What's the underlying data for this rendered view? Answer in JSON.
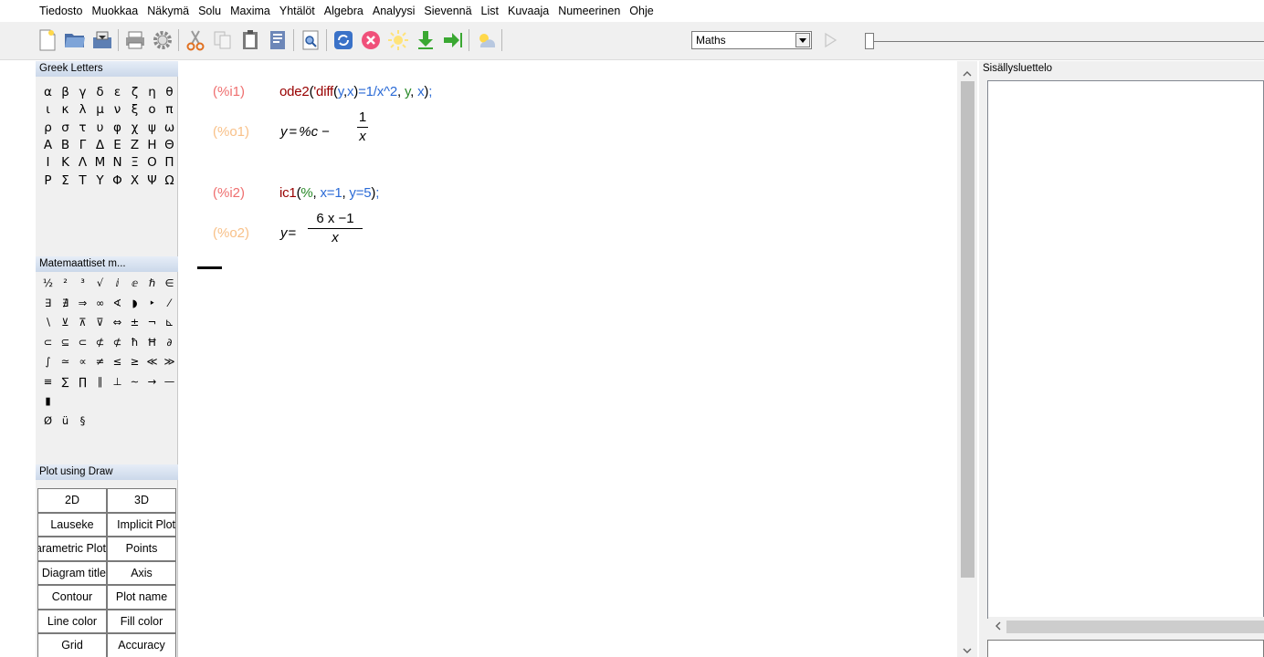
{
  "menu": [
    "Tiedosto",
    "Muokkaa",
    "Näkymä",
    "Solu",
    "Maxima",
    "Yhtälöt",
    "Algebra",
    "Analyysi",
    "Sievennä",
    "List",
    "Kuvaaja",
    "Numeerinen",
    "Ohje"
  ],
  "toolbar": {
    "cell_type": "Maths",
    "icons": [
      "new-document-icon",
      "open-folder-icon",
      "save-icon",
      "print-icon",
      "settings-gear-icon",
      "cut-scissors-icon",
      "copy-icon",
      "paste-icon",
      "select-all-icon",
      "find-icon",
      "interrupt-refresh-icon",
      "stop-icon",
      "sun-icon",
      "evaluate-down-icon",
      "evaluate-all-icon",
      "animation-icon",
      "play-icon"
    ]
  },
  "sidebar": {
    "greek": {
      "title": "Greek Letters",
      "rows": [
        [
          "α",
          "β",
          "γ",
          "δ",
          "ε",
          "ζ",
          "η",
          "θ"
        ],
        [
          "ι",
          "κ",
          "λ",
          "μ",
          "ν",
          "ξ",
          "ο",
          "π"
        ],
        [
          "ρ",
          "σ",
          "τ",
          "υ",
          "φ",
          "χ",
          "ψ",
          "ω"
        ],
        [
          "Α",
          "Β",
          "Γ",
          "Δ",
          "Ε",
          "Ζ",
          "Η",
          "Θ"
        ],
        [
          "Ι",
          "Κ",
          "Λ",
          "Μ",
          "Ν",
          "Ξ",
          "Ο",
          "Π"
        ],
        [
          "Ρ",
          "Σ",
          "Τ",
          "Υ",
          "Φ",
          "Χ",
          "Ψ",
          "Ω"
        ]
      ]
    },
    "math": {
      "title": "Matemaattiset m...",
      "rows": [
        [
          "½",
          "²",
          "³",
          "√",
          "ⅈ",
          "ⅇ",
          "ℏ",
          "∈"
        ],
        [
          "∃",
          "∄",
          "⇒",
          "∞",
          "∢",
          "◗",
          "‣",
          "⁄"
        ],
        [
          "∖",
          "⊻",
          "⊼",
          "⊽",
          "⇔",
          "±",
          "¬",
          "⊾"
        ],
        [
          "⊂",
          "⊆",
          "⊂",
          "⊄",
          "⊄",
          "ħ",
          "Ħ",
          "∂"
        ],
        [
          "∫",
          "≃",
          "∝",
          "≠",
          "≤",
          "≥",
          "≪",
          "≫"
        ],
        [
          "≡",
          "∑",
          "∏",
          "∥",
          "⊥",
          "∼",
          "→",
          "—"
        ],
        [
          "▮"
        ],
        [
          "Ø",
          "ü",
          "§"
        ]
      ]
    },
    "draw": {
      "title": "Plot using Draw",
      "buttons": [
        "2D",
        "3D",
        "Lauseke",
        "Implicit Plot",
        "Parametric Plot",
        "Points",
        "Diagram title",
        "Axis",
        "Contour",
        "Plot name",
        "Line color",
        "Fill color",
        "Grid",
        "Accuracy"
      ]
    }
  },
  "worksheet": {
    "cells": [
      {
        "in_label": "(%i1)",
        "out_label": "(%o1)",
        "input": {
          "fn": "ode2",
          "q": "'",
          "diff": "diff",
          "y": "y",
          "x": "x",
          "rest": "=1/x^2",
          "y2": "y",
          "x2": "x"
        }
      },
      {
        "in_label": "(%i2)",
        "out_label": "(%o2)",
        "input": {
          "fn": "ic1",
          "pct": "%",
          "x": "x",
          "xval": "=1",
          "y": "y",
          "yval": "=5"
        }
      }
    ],
    "out1": {
      "lhs": "y",
      "eq": "=",
      "const": "%c",
      "minus": "−",
      "num": "1",
      "den": "x"
    },
    "out2": {
      "lhs": "y",
      "eq": "=",
      "num": "6 x −1",
      "den": "x"
    }
  },
  "toc": {
    "title": "Sisällysluettelo"
  }
}
